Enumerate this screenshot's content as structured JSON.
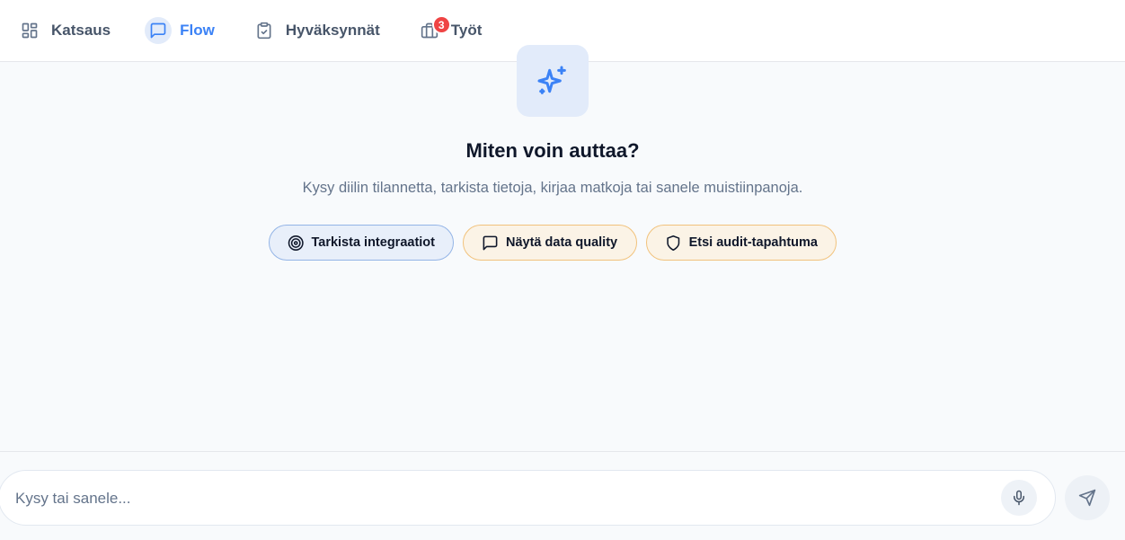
{
  "nav": {
    "items": [
      {
        "label": "Katsaus",
        "icon": "dashboard-grid-icon",
        "active": false
      },
      {
        "label": "Flow",
        "icon": "chat-bubble-icon",
        "active": true
      },
      {
        "label": "Hyväksynnät",
        "icon": "clipboard-check-icon",
        "active": false
      },
      {
        "label": "Työt",
        "icon": "briefcase-icon",
        "active": false,
        "badge": "3"
      }
    ]
  },
  "hero": {
    "icon": "sparkles-icon",
    "title": "Miten voin auttaa?",
    "subtitle": "Kysy diilin tilannetta, tarkista tietoja, kirjaa matkoja tai sanele muistiinpanoja."
  },
  "suggestions": [
    {
      "label": "Tarkista integraatiot",
      "icon": "target-icon"
    },
    {
      "label": "Näytä data quality",
      "icon": "message-square-icon"
    },
    {
      "label": "Etsi audit-tapahtuma",
      "icon": "shield-icon"
    }
  ],
  "composer": {
    "placeholder": "Kysy tai sanele...",
    "value": "",
    "mic_icon": "microphone-icon",
    "send_icon": "send-icon"
  },
  "colors": {
    "accent": "#3b82f6",
    "badge": "#ef4444",
    "chip_blue_border": "#93b4e6",
    "chip_orange_border": "#f1c27c"
  }
}
